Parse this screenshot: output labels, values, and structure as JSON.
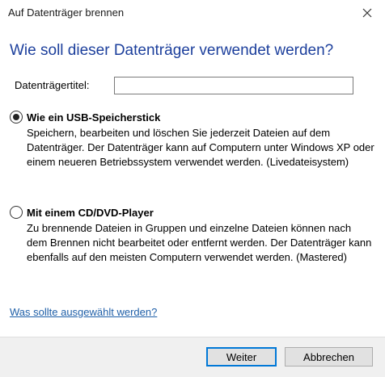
{
  "window": {
    "title": "Auf Datenträger brennen",
    "close_icon": "close-icon"
  },
  "heading": "Wie soll dieser Datenträger verwendet werden?",
  "form": {
    "disc_title_label": "Datenträgertitel:",
    "disc_title_value": "",
    "disc_title_placeholder": ""
  },
  "options": [
    {
      "label": "Wie ein USB-Speicherstick",
      "selected": true,
      "description": "Speichern, bearbeiten und löschen Sie jederzeit Dateien auf dem Datenträger. Der Datenträger kann auf Computern unter Windows XP oder einem neueren Betriebssystem verwendet werden. (Livedateisystem)"
    },
    {
      "label": "Mit einem CD/DVD-Player",
      "selected": false,
      "description": "Zu brennende Dateien in Gruppen und einzelne Dateien können nach dem Brennen nicht bearbeitet oder entfernt werden. Der Datenträger kann ebenfalls auf den meisten Computern verwendet werden. (Mastered)"
    }
  ],
  "help_link": "Was sollte ausgewählt werden?",
  "buttons": {
    "next": "Weiter",
    "cancel": "Abbrechen"
  },
  "colors": {
    "heading": "#1c3f9c",
    "link": "#1f5fa8",
    "primary_border": "#0078d7",
    "footer_bg": "#f0f0f0"
  }
}
